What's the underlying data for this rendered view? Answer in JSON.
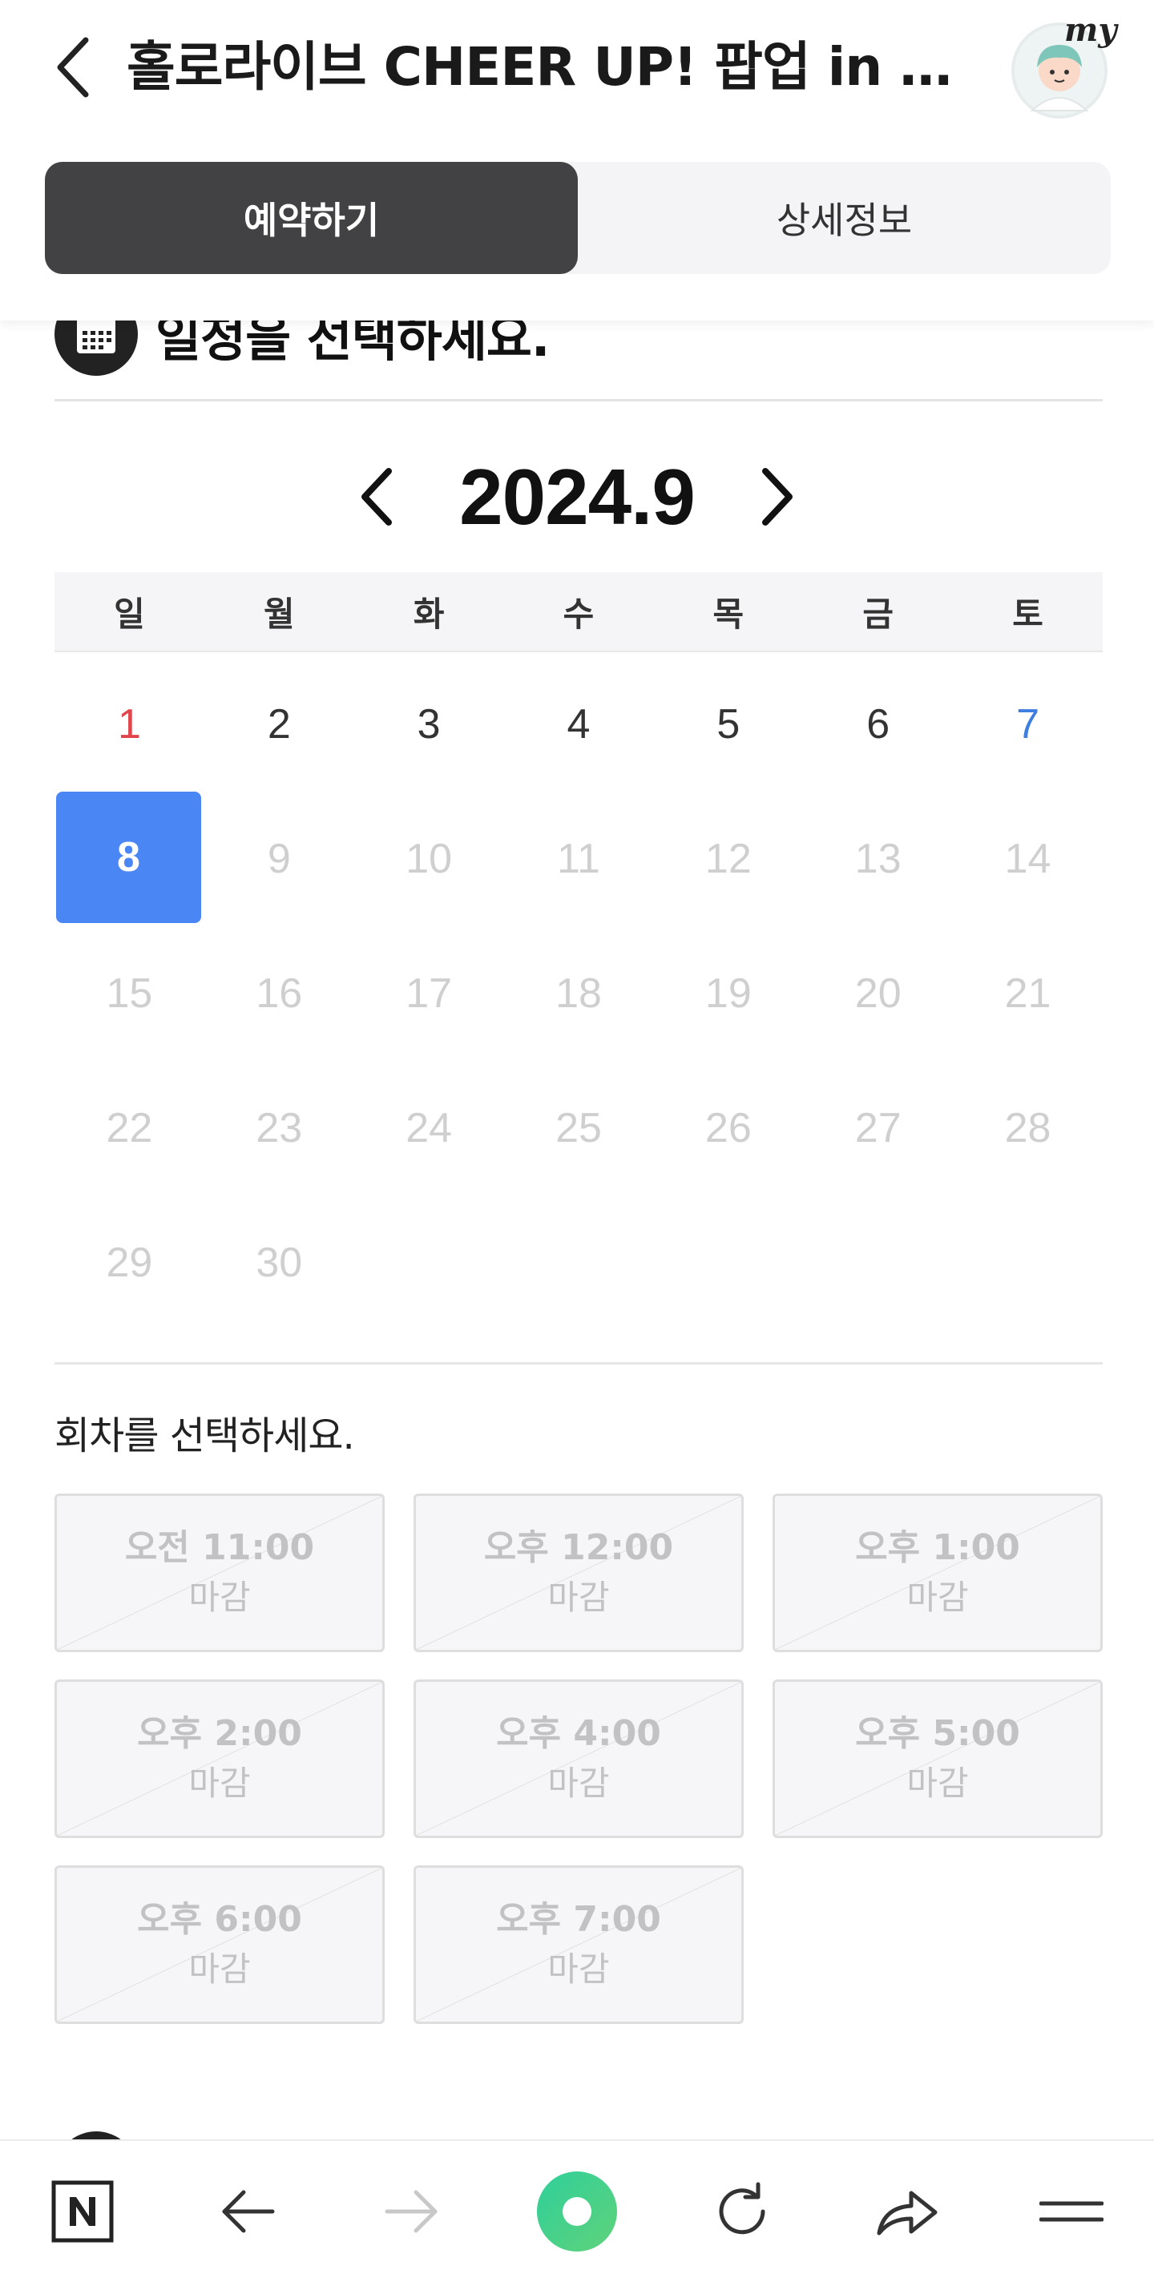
{
  "header": {
    "title": "홀로라이브 CHEER UP! 팝업 in KOREA",
    "avatar_badge": "my"
  },
  "tabs": [
    {
      "label": "예약하기",
      "active": true
    },
    {
      "label": "상세정보",
      "active": false
    }
  ],
  "date_section": {
    "heading": "일정을 선택하세요."
  },
  "calendar": {
    "month_label": "2024.9",
    "weekdays": [
      "일",
      "월",
      "화",
      "수",
      "목",
      "금",
      "토"
    ],
    "days": [
      "1",
      "2",
      "3",
      "4",
      "5",
      "6",
      "7",
      "8",
      "9",
      "10",
      "11",
      "12",
      "13",
      "14",
      "15",
      "16",
      "17",
      "18",
      "19",
      "20",
      "21",
      "22",
      "23",
      "24",
      "25",
      "26",
      "27",
      "28",
      "29",
      "30"
    ],
    "selected_day": "8"
  },
  "slots_section": {
    "title": "회차를 선택하세요.",
    "slots": [
      {
        "time": "오전 11:00",
        "status": "마감"
      },
      {
        "time": "오후 12:00",
        "status": "마감"
      },
      {
        "time": "오후 1:00",
        "status": "마감"
      },
      {
        "time": "오후 2:00",
        "status": "마감"
      },
      {
        "time": "오후 4:00",
        "status": "마감"
      },
      {
        "time": "오후 5:00",
        "status": "마감"
      },
      {
        "time": "오후 6:00",
        "status": "마감"
      },
      {
        "time": "오후 7:00",
        "status": "마감"
      }
    ]
  },
  "bottom_bar": {
    "icons": [
      "naver-home-icon",
      "back-arrow-icon",
      "forward-arrow-icon",
      "green-dot-icon",
      "reload-icon",
      "share-icon",
      "menu-icon"
    ]
  },
  "colors": {
    "accent_blue": "#4b86f5",
    "active_tab": "#424244",
    "sunday_red": "#e0454c",
    "saturday_blue": "#3e7ee0",
    "green_button": "#3ccf8e"
  }
}
